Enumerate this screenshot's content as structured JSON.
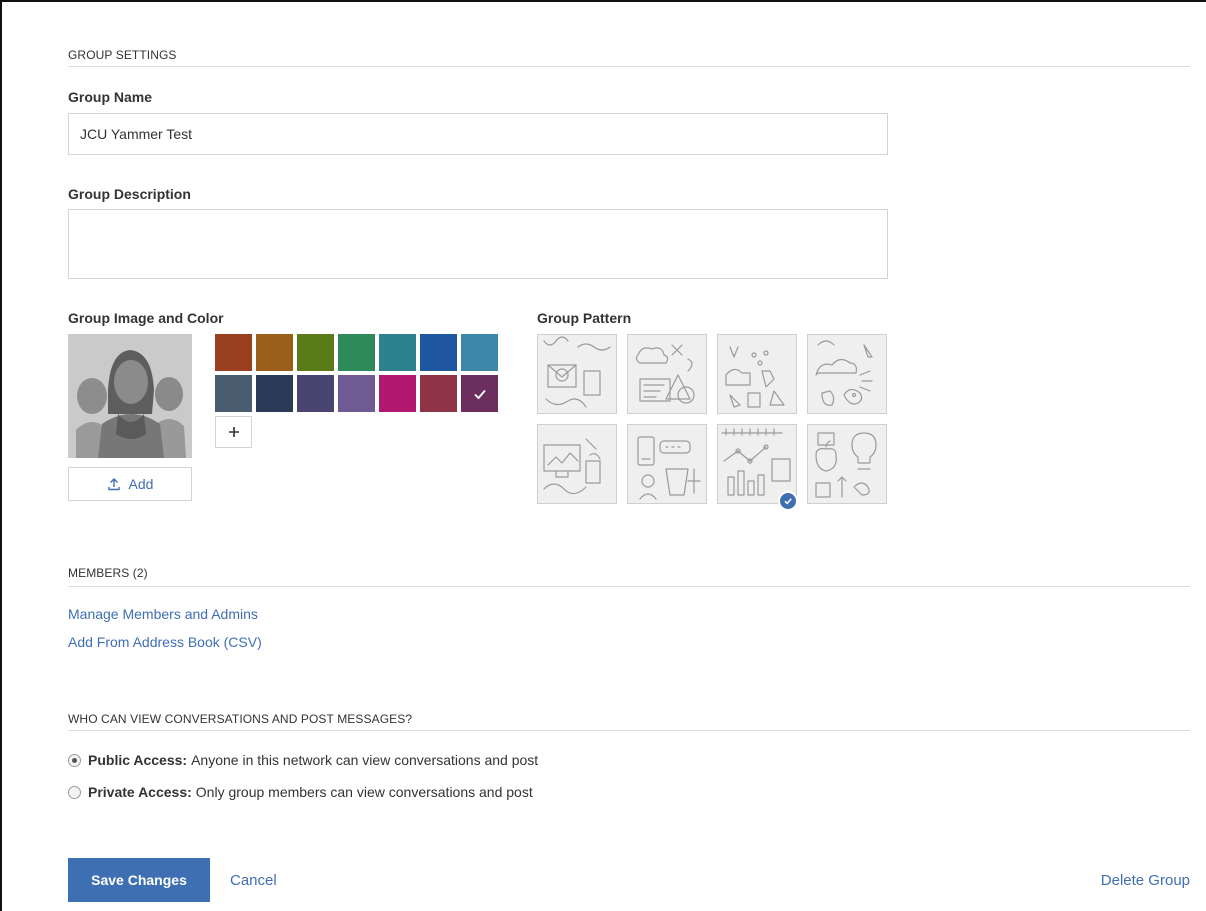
{
  "settings": {
    "section_title": "GROUP SETTINGS",
    "name_label": "Group Name",
    "name_value": "JCU Yammer Test",
    "description_label": "Group Description",
    "description_value": "",
    "image_color_label": "Group Image and Color",
    "add_label": "Add",
    "pattern_label": "Group Pattern"
  },
  "colors": {
    "swatches": [
      "#9a401f",
      "#9b5f1c",
      "#5b7a1a",
      "#2e8a5a",
      "#2e8290",
      "#1f56a0",
      "#3c86a8",
      "#4a5d70",
      "#2b3a56",
      "#4a4470",
      "#6f5a93",
      "#b3186f",
      "#8f3346",
      "#6b2e5e"
    ],
    "selected_index": 13,
    "accent": "#3f6fb3"
  },
  "patterns": {
    "count": 8,
    "selected_index": 6,
    "names": [
      "pattern-mail-coffee",
      "pattern-cloud-science",
      "pattern-likes-pointer",
      "pattern-cloud-bird",
      "pattern-monitor-plane",
      "pattern-phone-coffee",
      "pattern-chart",
      "pattern-apple-bulb"
    ]
  },
  "members": {
    "section_title": "MEMBERS (2)",
    "manage_link": "Manage Members and Admins",
    "address_book_link": "Add From Address Book (CSV)"
  },
  "access": {
    "section_title": "WHO CAN VIEW CONVERSATIONS AND POST MESSAGES?",
    "public_label": "Public Access:",
    "public_text": "Anyone in this network can view conversations and post",
    "private_label": "Private Access:",
    "private_text": "Only group members can view conversations and post",
    "selected": "public"
  },
  "actions": {
    "save_label": "Save Changes",
    "cancel_label": "Cancel",
    "delete_label": "Delete Group"
  }
}
